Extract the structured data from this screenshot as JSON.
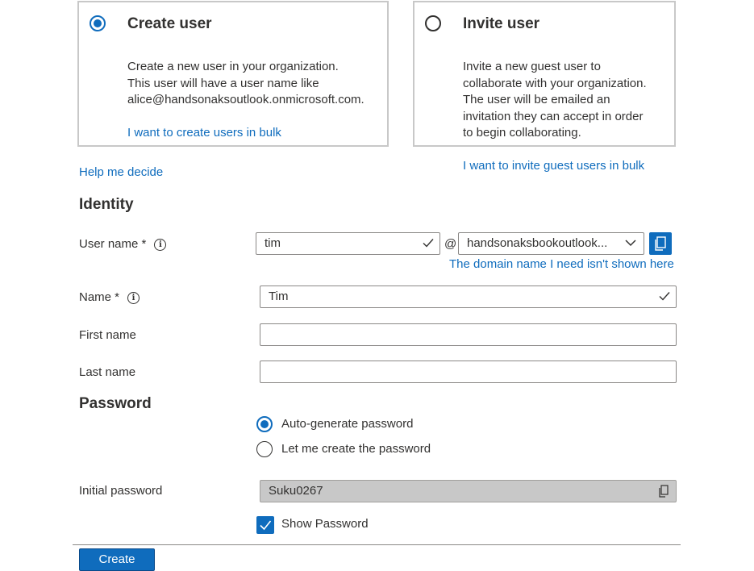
{
  "options": {
    "create": {
      "title": "Create user",
      "description": "Create a new user in your organization.\nThis user will have a user name like\nalice@handsonaksoutlook.onmicrosoft.com.",
      "link": "I want to create users in bulk",
      "selected": true
    },
    "invite": {
      "title": "Invite user",
      "description": "Invite a new guest user to\ncollaborate with your organization.\nThe user will be emailed an\ninvitation they can accept in order\nto begin collaborating.",
      "link": "I want to invite guest users in bulk",
      "selected": false
    }
  },
  "help_link": "Help me decide",
  "identity": {
    "section_title": "Identity",
    "username": {
      "label": "User name *",
      "value": "tim",
      "at": "@",
      "domain": "handsonaksbookoutlook...",
      "domain_link": "The domain name I need isn't shown here"
    },
    "name": {
      "label": "Name *",
      "value": "Tim"
    },
    "first_name": {
      "label": "First name",
      "value": ""
    },
    "last_name": {
      "label": "Last name",
      "value": ""
    }
  },
  "password": {
    "section_title": "Password",
    "auto_generate_label": "Auto-generate password",
    "custom_label": "Let me create the password",
    "selected": "auto",
    "initial_label": "Initial password",
    "initial_value": "Suku0267",
    "show_password_label": "Show Password",
    "show_password_checked": true
  },
  "create_button": "Create",
  "colors": {
    "accent": "#0f6cbd",
    "border": "#8a8886",
    "disabled_bg": "#c8c8c8"
  },
  "icons": [
    "radio-selected",
    "radio-empty",
    "info-icon",
    "checkmark-icon",
    "chevron-down-icon",
    "copy-icon",
    "checkbox-checked"
  ]
}
